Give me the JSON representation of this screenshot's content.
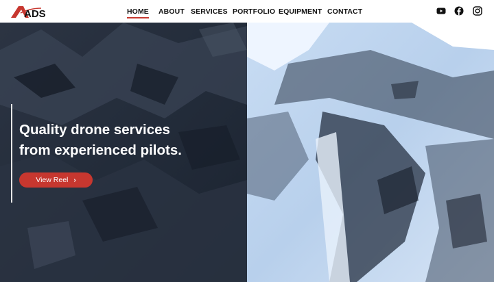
{
  "brand": {
    "logo_text": "ADS",
    "accent_color": "#c7372f"
  },
  "nav": {
    "items": [
      {
        "label": "HOME",
        "active": true
      },
      {
        "label": "ABOUT",
        "active": false
      },
      {
        "label": "SERVICES",
        "active": false
      },
      {
        "label": "PORTFOLIO",
        "active": false
      },
      {
        "label": "EQUIPMENT",
        "active": false
      },
      {
        "label": "CONTACT",
        "active": false
      }
    ]
  },
  "social": {
    "icons": [
      "youtube-icon",
      "facebook-icon",
      "instagram-icon"
    ]
  },
  "hero": {
    "headline_line1": "Quality drone services",
    "headline_line2": "from experienced pilots.",
    "button_label": "View Reel",
    "button_icon": "chevron-right-icon",
    "overlay_color": "#1e2a3a"
  }
}
